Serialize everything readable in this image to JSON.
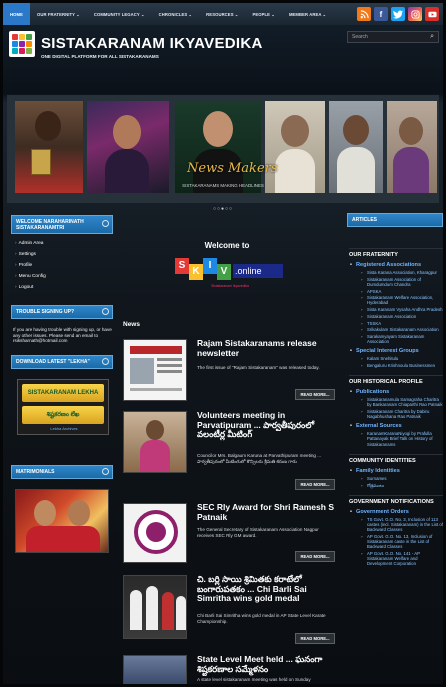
{
  "nav": {
    "items": [
      {
        "label": "HOME",
        "active": true
      },
      {
        "label": "OUR FRATERNITY ⌄"
      },
      {
        "label": "COMMUNITY LEGACY ⌄"
      },
      {
        "label": "CHRONICLES ⌄"
      },
      {
        "label": "RESOURCES ⌄"
      },
      {
        "label": "PEOPLE ⌄"
      },
      {
        "label": "MEMBER AREA ⌄"
      }
    ],
    "social_icons": [
      "rss-icon",
      "facebook-icon",
      "twitter-icon",
      "instagram-icon",
      "youtube-icon"
    ]
  },
  "header": {
    "title": "SISTAKARANAM IKYAVEDIKA",
    "tagline": "ONE DIGITAL PLATFORM FOR ALL SISTAKARANAMS",
    "search_placeholder": "Search"
  },
  "slider": {
    "caption_title": "News Makers",
    "caption_sub": "SISTAKARANAMS MAKING HEADLINES",
    "dots": "○○●○○"
  },
  "left": {
    "welcome_head": "WELCOME NARAHARINATH SISTAKARANAMTRI",
    "menu": [
      "Admin Area",
      "Settings",
      "Profile",
      "Menu Config",
      "Logout"
    ],
    "trouble_head": "TROUBLE SIGNING UP?",
    "trouble_text": "If you are having trouble with signing up, or have any other issues. Please send an email to rsiksharnath@hotmail.com",
    "lekha_head": "DOWNLOAD LATEST \"LEKHA\"",
    "lekha_1": "SISTAKARANAM LEKHA",
    "lekha_2": "శిష్టకరణం లేఖ",
    "lekha_link": "Lekha Archives",
    "matrimonials_head": "MATRIMONIALS"
  },
  "center": {
    "welcome": "Welcome to",
    "logo_letters": [
      "S",
      "K",
      "I",
      "V"
    ],
    "logo_online": ".online",
    "logo_sub": "Sistakaranam Ikyavedika",
    "news_heading": "News",
    "read_more": "READ MORE...",
    "news": [
      {
        "title": "Rajam Sistakaranams release newsletter",
        "desc": "The first issue of \"Rajam Sistakaranam\" was released today."
      },
      {
        "title": "Volunteers meeting in Parvatipuram ... పార్వతీపురంలో వలంటీర్ల మీటింగ్",
        "desc": "Councilor Mrs. Balgaum Karuna at Parvathipuram meeting ... పార్వతీపురంలో మీటింగులో కౌన్సిలరు శ్రీమతి కరుణ గారు"
      },
      {
        "title": "SEC Rly Award for Shri Ramesh S Patnaik",
        "desc": "The General Secretary of Sistakaranam Association Nagpur receives SEC Rly GM award."
      },
      {
        "title": "చి. బర్లి సాయి శ్రిమితకు కరాటేలో బంగారుపతకం ... Chi Barli Sai Simritha wins gold medal",
        "desc": "Chi Barli Sai Simritha wins gold medal in AP State Level Karate Championship."
      },
      {
        "title": "State Level Meet held ... ఘనంగా శిష్టకరణాల సమ్మేళనం",
        "desc": "A state level sistakaranam meeting was held on Sunday"
      }
    ]
  },
  "right": {
    "head": "ARTICLES",
    "sections": [
      {
        "title": "OUR FRATERNITY",
        "groups": [
          {
            "name": "Registered Associations",
            "links": [
              "Sista Karana Association, Kharagpur",
              "Sistakaranam Association of Dumdumdum Chandra",
              "APSKA",
              "Sistakaranam Welfare Association, Hyderabad",
              "Sista Karanam Vysaha Andhra Pradesh",
              "Sistakaranam Association",
              "TSSKA",
              "Srikakulam Sistakaranam Association",
              "Sarakamyayam Sistakaranam Association"
            ]
          },
          {
            "name": "Special Interest Groups",
            "links": [
              "Kalam Snehitulu",
              "Bengaluru Krishnoulu Businessmen"
            ]
          }
        ]
      },
      {
        "title": "OUR HISTORICAL PROFILE",
        "groups": [
          {
            "name": "Publications",
            "links": [
              "Sistakaranamula Samagraha Charitra by Bankaranam Chiaparthi Rao Patnaik",
              "Sistakaranam Charitra by Dabiru Nagabhushana Rao Patnaik"
            ]
          },
          {
            "name": "External Sources",
            "links": [
              "KaranamKaranaNiyogi by Prafulla Pattanayak Brief Talk on History of Sistakaranams"
            ]
          }
        ]
      },
      {
        "title": "COMMUNITY IDENTITIES",
        "groups": [
          {
            "name": "Family Identities",
            "links": [
              "Surnames",
              "గోత్రములు"
            ]
          }
        ]
      },
      {
        "title": "GOVERNMENT NOTIFICATIONS",
        "groups": [
          {
            "name": "Government Orders",
            "links": [
              "TS Govt. G.O. No. 3, Inclusion of 113 castes (incl. Sistakaranam) in the List of Backward Classes",
              "AP Govt. G.O. No. 13, Inclusion of Sistakaranam caste in the List of Backward Classes",
              "AP Govt. G.O. No. 141 - AP Sistakaranam Welfare and Development Corporation"
            ]
          }
        ]
      }
    ]
  }
}
